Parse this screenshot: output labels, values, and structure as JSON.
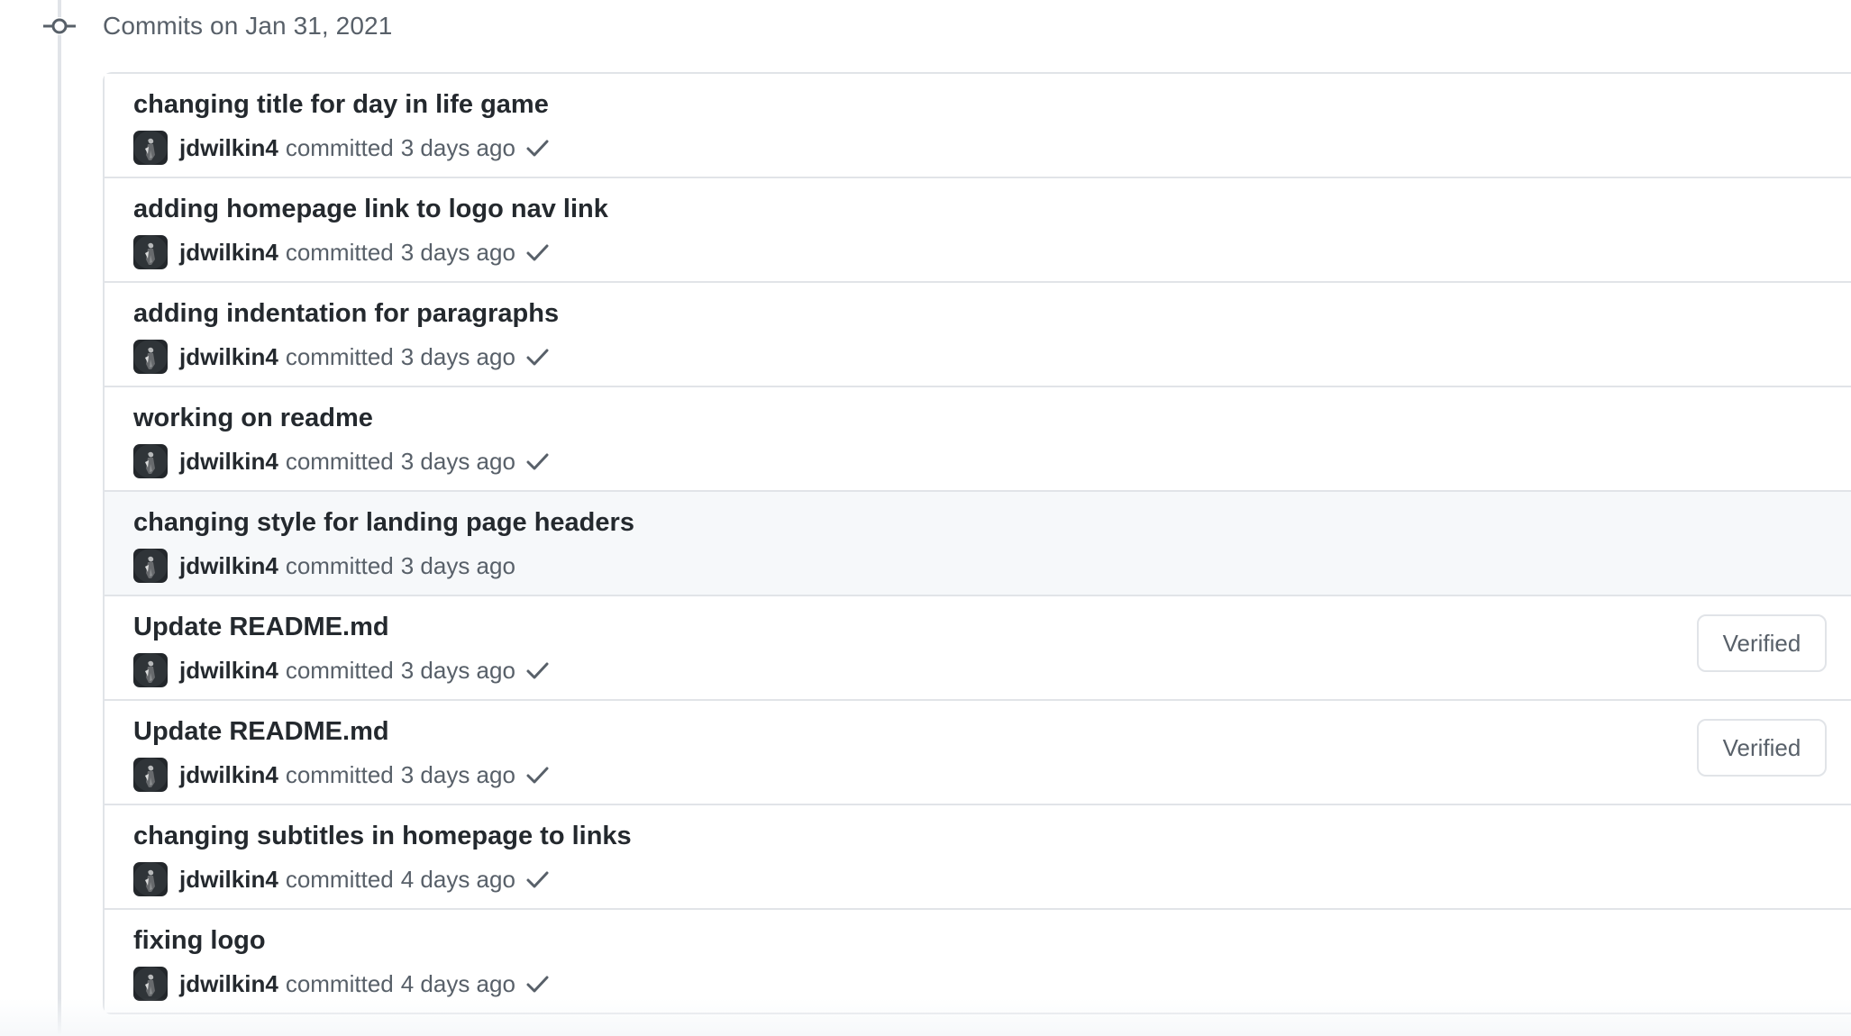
{
  "group": {
    "title": "Commits on Jan 31, 2021"
  },
  "labels": {
    "committed": "committed"
  },
  "commits": [
    {
      "title": "changing title for day in life game",
      "author": "jdwilkin4",
      "time": "3 days ago",
      "status_check": true,
      "verified": null
    },
    {
      "title": "adding homepage link to logo nav link",
      "author": "jdwilkin4",
      "time": "3 days ago",
      "status_check": true,
      "verified": null
    },
    {
      "title": "adding indentation for paragraphs",
      "author": "jdwilkin4",
      "time": "3 days ago",
      "status_check": true,
      "verified": null
    },
    {
      "title": "working on readme",
      "author": "jdwilkin4",
      "time": "3 days ago",
      "status_check": true,
      "verified": null
    },
    {
      "title": "changing style for landing page headers",
      "author": "jdwilkin4",
      "time": "3 days ago",
      "status_check": false,
      "verified": null
    },
    {
      "title": "Update README.md",
      "author": "jdwilkin4",
      "time": "3 days ago",
      "status_check": true,
      "verified": "Verified"
    },
    {
      "title": "Update README.md",
      "author": "jdwilkin4",
      "time": "3 days ago",
      "status_check": true,
      "verified": "Verified"
    },
    {
      "title": "changing subtitles in homepage to links",
      "author": "jdwilkin4",
      "time": "4 days ago",
      "status_check": true,
      "verified": null
    },
    {
      "title": "fixing logo",
      "author": "jdwilkin4",
      "time": "4 days ago",
      "status_check": true,
      "verified": null
    }
  ],
  "icons": {
    "group_icon": "git-commit-icon",
    "status_icon": "check-icon",
    "avatar": "author-avatar"
  },
  "colors": {
    "border": "#e1e4e8",
    "muted_text": "#586069",
    "primary_text": "#24292e",
    "hover_row": "#f6f8fa"
  },
  "state": {
    "hovered_row_index": 4
  }
}
